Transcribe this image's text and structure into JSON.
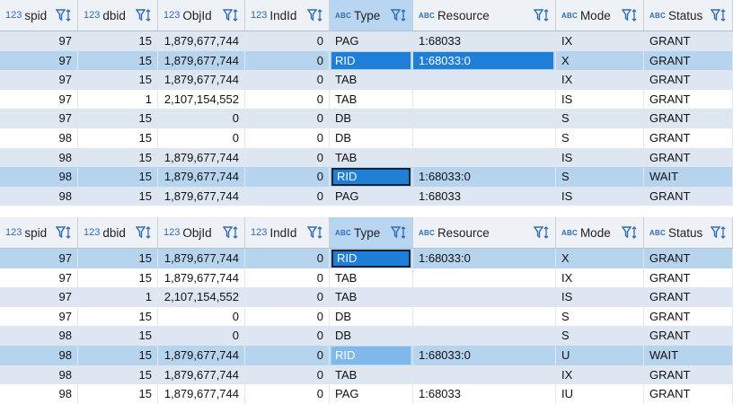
{
  "columns": [
    {
      "type": "123",
      "label": "spid"
    },
    {
      "type": "123",
      "label": "dbid"
    },
    {
      "type": "123",
      "label": "ObjId"
    },
    {
      "type": "123",
      "label": "IndId"
    },
    {
      "type": "ABC",
      "label": "Type"
    },
    {
      "type": "ABC",
      "label": "Resource"
    },
    {
      "type": "ABC",
      "label": "Mode"
    },
    {
      "type": "ABC",
      "label": "Status"
    }
  ],
  "filter_icon": "filter-sort-icon",
  "grids": [
    {
      "rows": [
        [
          "97",
          "15",
          "1,879,677,744",
          "0",
          "PAG",
          "1:68033",
          "IX",
          "GRANT"
        ],
        [
          "97",
          "15",
          "1,879,677,744",
          "0",
          "RID",
          "1:68033:0",
          "X",
          "GRANT"
        ],
        [
          "97",
          "15",
          "1,879,677,744",
          "0",
          "TAB",
          "",
          "IX",
          "GRANT"
        ],
        [
          "97",
          "1",
          "2,107,154,552",
          "0",
          "TAB",
          "",
          "IS",
          "GRANT"
        ],
        [
          "97",
          "15",
          "0",
          "0",
          "DB",
          "",
          "S",
          "GRANT"
        ],
        [
          "98",
          "15",
          "0",
          "0",
          "DB",
          "",
          "S",
          "GRANT"
        ],
        [
          "98",
          "15",
          "1,879,677,744",
          "0",
          "TAB",
          "",
          "IS",
          "GRANT"
        ],
        [
          "98",
          "15",
          "1,879,677,744",
          "0",
          "RID",
          "1:68033:0",
          "S",
          "WAIT"
        ],
        [
          "98",
          "15",
          "1,879,677,744",
          "0",
          "PAG",
          "1:68033",
          "IS",
          "GRANT"
        ]
      ]
    },
    {
      "rows": [
        [
          "97",
          "15",
          "1,879,677,744",
          "0",
          "RID",
          "1:68033:0",
          "X",
          "GRANT"
        ],
        [
          "97",
          "15",
          "1,879,677,744",
          "0",
          "TAB",
          "",
          "IX",
          "GRANT"
        ],
        [
          "97",
          "1",
          "2,107,154,552",
          "0",
          "TAB",
          "",
          "IS",
          "GRANT"
        ],
        [
          "97",
          "15",
          "0",
          "0",
          "DB",
          "",
          "S",
          "GRANT"
        ],
        [
          "98",
          "15",
          "0",
          "0",
          "DB",
          "",
          "S",
          "GRANT"
        ],
        [
          "98",
          "15",
          "1,879,677,744",
          "0",
          "RID",
          "1:68033:0",
          "U",
          "WAIT"
        ],
        [
          "98",
          "15",
          "1,879,677,744",
          "0",
          "TAB",
          "",
          "IX",
          "GRANT"
        ],
        [
          "98",
          "15",
          "1,879,677,744",
          "0",
          "PAG",
          "1:68033",
          "IU",
          "GRANT"
        ]
      ]
    }
  ],
  "colors": {
    "accent": "#1f7fd6",
    "row_alt": "#dde6f1",
    "row_highlight": "#b7d4ef",
    "header_bg": "#eef1f5"
  }
}
